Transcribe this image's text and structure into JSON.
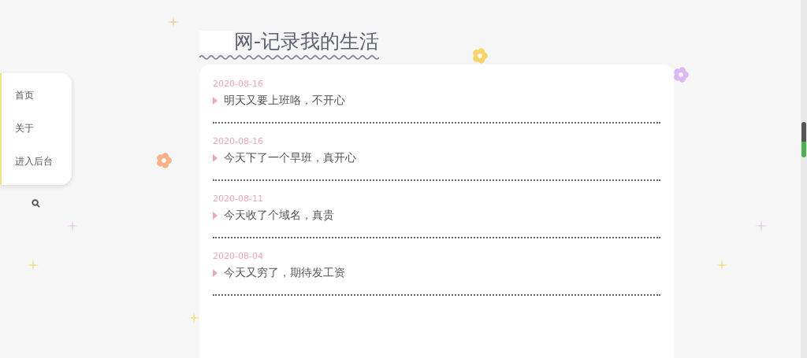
{
  "site_title": "网-记录我的生活",
  "nav": [
    {
      "label": "首页"
    },
    {
      "label": "关于"
    },
    {
      "label": "进入后台"
    }
  ],
  "posts": [
    {
      "date": "2020-08-16",
      "title": "明天又要上班咯，不开心"
    },
    {
      "date": "2020-08-16",
      "title": "今天下了一个早班，真开心"
    },
    {
      "date": "2020-08-11",
      "title": "今天收了个域名，真贵"
    },
    {
      "date": "2020-08-04",
      "title": "今天又穷了，期待发工资"
    }
  ]
}
